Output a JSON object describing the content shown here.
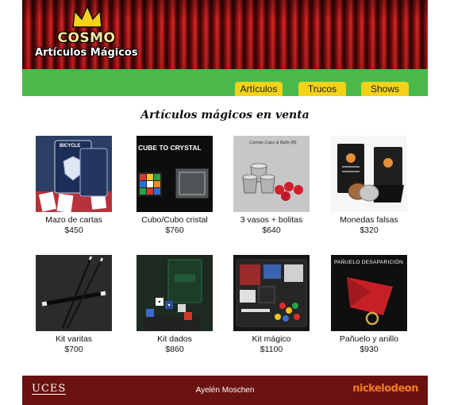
{
  "brand": {
    "title": "COSMO",
    "subtitle": "Artículos Mágicos"
  },
  "nav": [
    {
      "label": "Artículos"
    },
    {
      "label": "Trucos"
    },
    {
      "label": "Shows"
    }
  ],
  "section_title": "Artículos mágicos en venta",
  "products": [
    {
      "name": "Mazo de cartas",
      "price": "$450",
      "image_label": "BICYCLE"
    },
    {
      "name": "Cubo/Cubo cristal",
      "price": "$760",
      "image_label": "CUBE TO CRYSTAL"
    },
    {
      "name": "3 vasos + bolitas",
      "price": "$640",
      "image_label": "Combo Cups & Balls (B)"
    },
    {
      "name": "Monedas falsas",
      "price": "$320"
    },
    {
      "name": "Kit varitas",
      "price": "$700"
    },
    {
      "name": "Kit dados",
      "price": "$860"
    },
    {
      "name": "Kit mágico",
      "price": "$1100"
    },
    {
      "name": "Pañuelo y anillo",
      "price": "$930",
      "image_label": "PAÑUELO DESAPARICIÓN"
    }
  ],
  "footer": {
    "left_logo": "UCES",
    "author": "Ayelén Moschen",
    "right_logo": "nickelodeon"
  },
  "colors": {
    "nav_bar": "#4bb94a",
    "nav_button": "#f3d21a",
    "footer": "#6a1210",
    "curtain": "#b3191b",
    "nick_orange": "#f57c1f"
  }
}
